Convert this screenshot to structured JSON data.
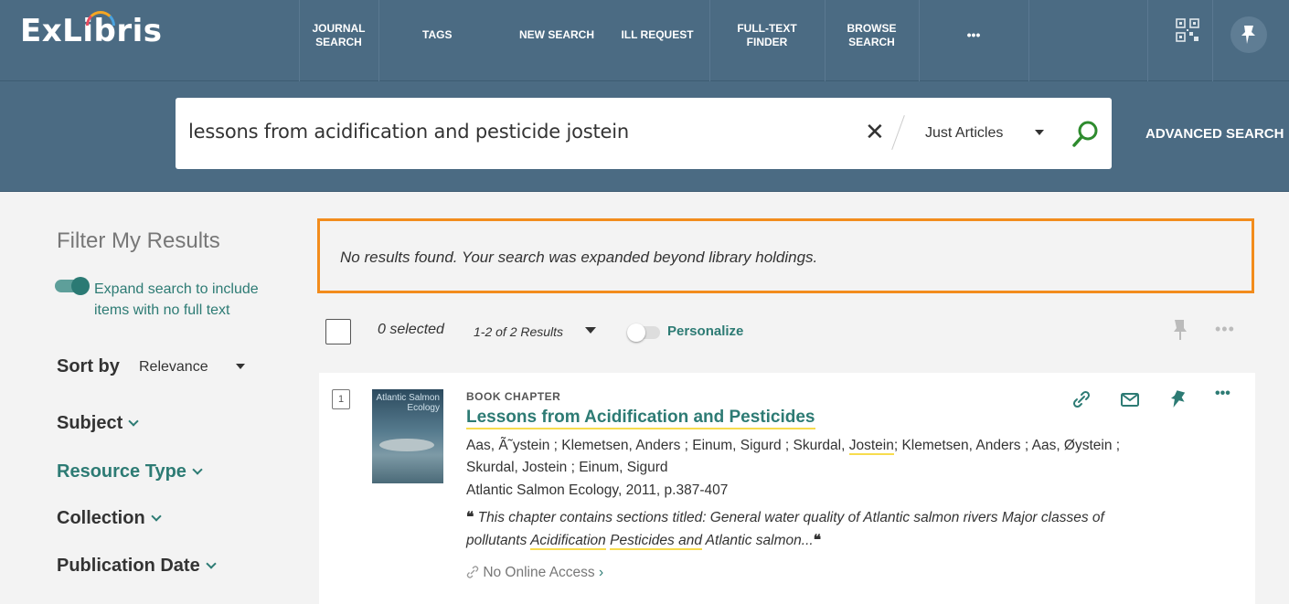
{
  "header": {
    "logo": "ExLibris",
    "nav": [
      {
        "line1": "JOURNAL",
        "line2": "SEARCH"
      },
      {
        "line1": "TAGS",
        "line2": ""
      },
      {
        "line1": "NEW SEARCH",
        "line2": ""
      },
      {
        "line1": "ILL REQUEST",
        "line2": ""
      },
      {
        "line1": "FULL-TEXT",
        "line2": "FINDER"
      },
      {
        "line1": "BROWSE",
        "line2": "SEARCH"
      },
      {
        "line1": "•••",
        "line2": ""
      }
    ]
  },
  "search": {
    "query": "lessons from acidification and pesticide jostein",
    "clear": "✕",
    "scope": "Just Articles",
    "advanced": "ADVANCED SEARCH"
  },
  "sidebar": {
    "title": "Filter My Results",
    "expand_line1": "Expand search to include",
    "expand_line2": "items with no full text",
    "sort_label": "Sort by",
    "sort_value": "Relevance",
    "facets": [
      "Subject",
      "Resource Type",
      "Collection",
      "Publication Date"
    ]
  },
  "results": {
    "notice": "No results found. Your search was expanded beyond library holdings.",
    "selected": "0 selected",
    "count": "1-2 of 2 Results",
    "personalize": "Personalize",
    "more": "•••",
    "items": [
      {
        "number": "1",
        "cover_title": "Atlantic Salmon Ecology",
        "type": "BOOK CHAPTER",
        "title": "Lessons from Acidification and Pesticides",
        "authors_a": "Aas, Ã˜ystein ; Klemetsen, Anders ; Einum, Sigurd ; Skurdal, ",
        "authors_hl": "Jostein",
        "authors_b": "; Klemetsen, Anders ; Aas, Øystein ; Skurdal, Jostein ; Einum, Sigurd",
        "source": "Atlantic Salmon Ecology, 2011, p.387-407",
        "snippet_a": "This chapter contains sections titled: General water quality of Atlantic salmon rivers Major classes of pollutants ",
        "snippet_hl1": "Acidification",
        "snippet_hl2": "Pesticides and",
        "snippet_b": " Atlantic salmon...",
        "access": "No Online Access"
      }
    ]
  }
}
